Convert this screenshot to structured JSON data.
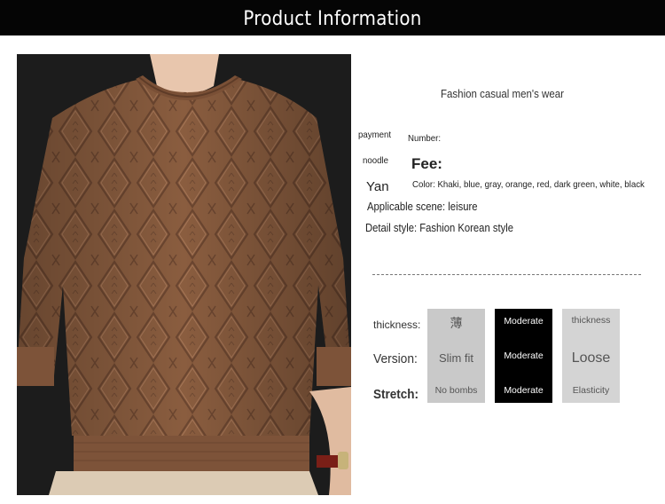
{
  "header": {
    "title": "Product Information"
  },
  "product": {
    "tagline": "Fashion casual men's wear",
    "payment_label": "payment",
    "number_label": "Number:",
    "noodle_label": "noodle",
    "fee_label": "Fee:",
    "yan_label": "Yan",
    "color_line": "Color: Khaki, blue, gray, orange, red, dark green, white, black",
    "scene_line": "Applicable scene: leisure",
    "style_line": "Detail style: Fashion Korean style"
  },
  "attributes": {
    "row_labels": {
      "thickness": "thickness:",
      "version": "Version:",
      "stretch": "Stretch:"
    },
    "columns": [
      {
        "top": "薄",
        "middle": "Slim fit",
        "bottom": "No bombs"
      },
      {
        "top": "Moderate",
        "middle": "Moderate",
        "bottom": "Moderate"
      },
      {
        "top": "thickness",
        "middle": "Loose",
        "bottom": "Elasticity"
      }
    ]
  },
  "colors": {
    "header_bg": "#050505",
    "sweater": "#8a5d3f",
    "column_light": "#c9c9c9",
    "column_selected": "#000000"
  }
}
